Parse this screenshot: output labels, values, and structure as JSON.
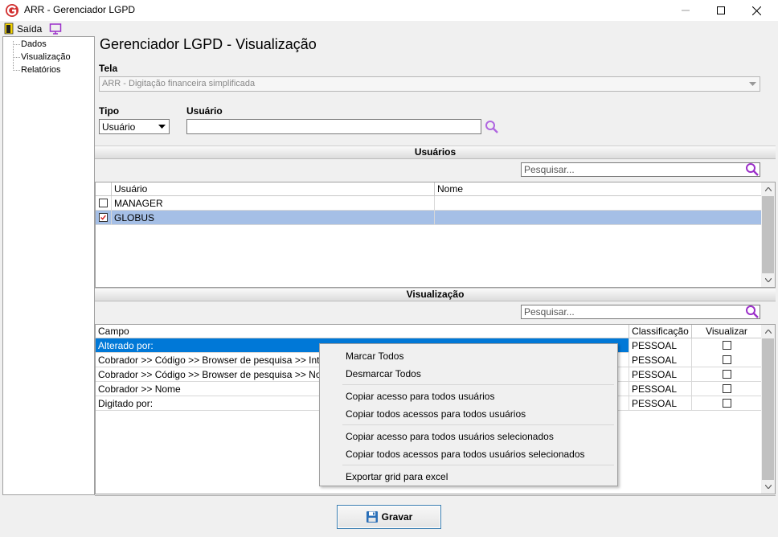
{
  "window": {
    "title": "ARR - Gerenciador LGPD",
    "minimize": "–",
    "maximize": "☐",
    "close": "✕"
  },
  "menu": {
    "exit_label": "Saída"
  },
  "tree": {
    "items": [
      "Dados",
      "Visualização",
      "Relatórios"
    ]
  },
  "page": {
    "title": "Gerenciador LGPD - Visualização"
  },
  "form": {
    "screen_label": "Tela",
    "screen_value": "ARR - Digitação financeira simplificada",
    "type_label": "Tipo",
    "type_value": "Usuário",
    "user_label": "Usuário",
    "user_value": ""
  },
  "users_section": {
    "header": "Usuários",
    "search_placeholder": "Pesquisar...",
    "columns": [
      "Usuário",
      "Nome"
    ],
    "rows": [
      {
        "user": "MANAGER",
        "name": "",
        "checked": false
      },
      {
        "user": "GLOBUS",
        "name": "",
        "checked": true
      }
    ]
  },
  "view_section": {
    "header": "Visualização",
    "search_placeholder": "Pesquisar...",
    "columns": [
      "Campo",
      "Classificação",
      "Visualizar"
    ],
    "rows": [
      {
        "field": "Alterado por:",
        "class": "PESSOAL"
      },
      {
        "field": "Cobrador >> Código >> Browser de pesquisa >> Interno",
        "class": "PESSOAL"
      },
      {
        "field": "Cobrador >> Código >> Browser de pesquisa >> Nome",
        "class": "PESSOAL"
      },
      {
        "field": "Cobrador >> Nome",
        "class": "PESSOAL"
      },
      {
        "field": "Digitado por:",
        "class": "PESSOAL"
      }
    ]
  },
  "context_menu": {
    "items": [
      "Marcar Todos",
      "Desmarcar Todos",
      "Copiar acesso para todos usuários",
      "Copiar todos acessos para todos usuários",
      "Copiar acesso para todos usuários selecionados",
      "Copiar todos acessos para todos usuários selecionados",
      "Exportar grid para excel"
    ]
  },
  "footer": {
    "save_label": "Gravar"
  },
  "colors": {
    "selection": "#0078d7",
    "selected_row": "#a5bfe6",
    "accent_purple": "#9b2fc9",
    "logo_red": "#d12f2f"
  }
}
